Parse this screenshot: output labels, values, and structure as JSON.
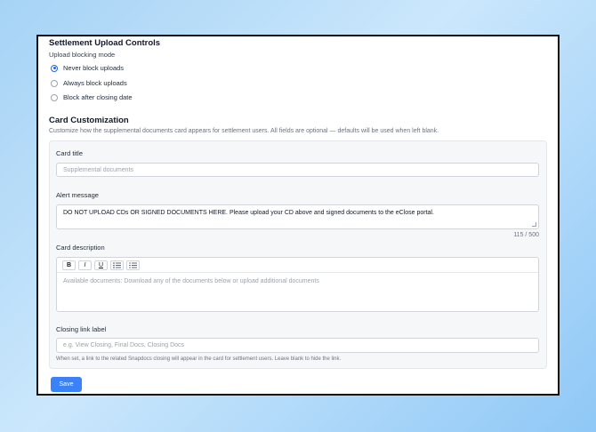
{
  "settlement": {
    "title": "Settlement Upload Controls",
    "mode_label": "Upload blocking mode",
    "options": [
      {
        "label": "Never block uploads",
        "checked": true
      },
      {
        "label": "Always block uploads",
        "checked": false
      },
      {
        "label": "Block after closing date",
        "checked": false
      }
    ]
  },
  "card": {
    "title": "Card Customization",
    "description": "Customize how the supplemental documents card appears for settlement users. All fields are optional — defaults will be used when left blank.",
    "card_title_label": "Card title",
    "card_title_placeholder": "Supplemental documents",
    "alert_label": "Alert message",
    "alert_value": "DO NOT UPLOAD CDs OR SIGNED DOCUMENTS HERE.  Please upload your CD above and signed documents to the eClose portal.",
    "alert_counter": "115 / 500",
    "description_label": "Card description",
    "toolbar": {
      "bold": "B",
      "italic": "I",
      "underline": "U"
    },
    "description_placeholder": "Available documents: Download any of the documents below or upload additional documents",
    "closing_link_label": "Closing link label",
    "closing_link_placeholder": "e.g. View Closing, Final Docs, Closing Docs",
    "closing_link_hint": "When set, a link to the related Snapdocs closing will appear in the card for settlement users. Leave blank to hide the link."
  },
  "save_label": "Save"
}
